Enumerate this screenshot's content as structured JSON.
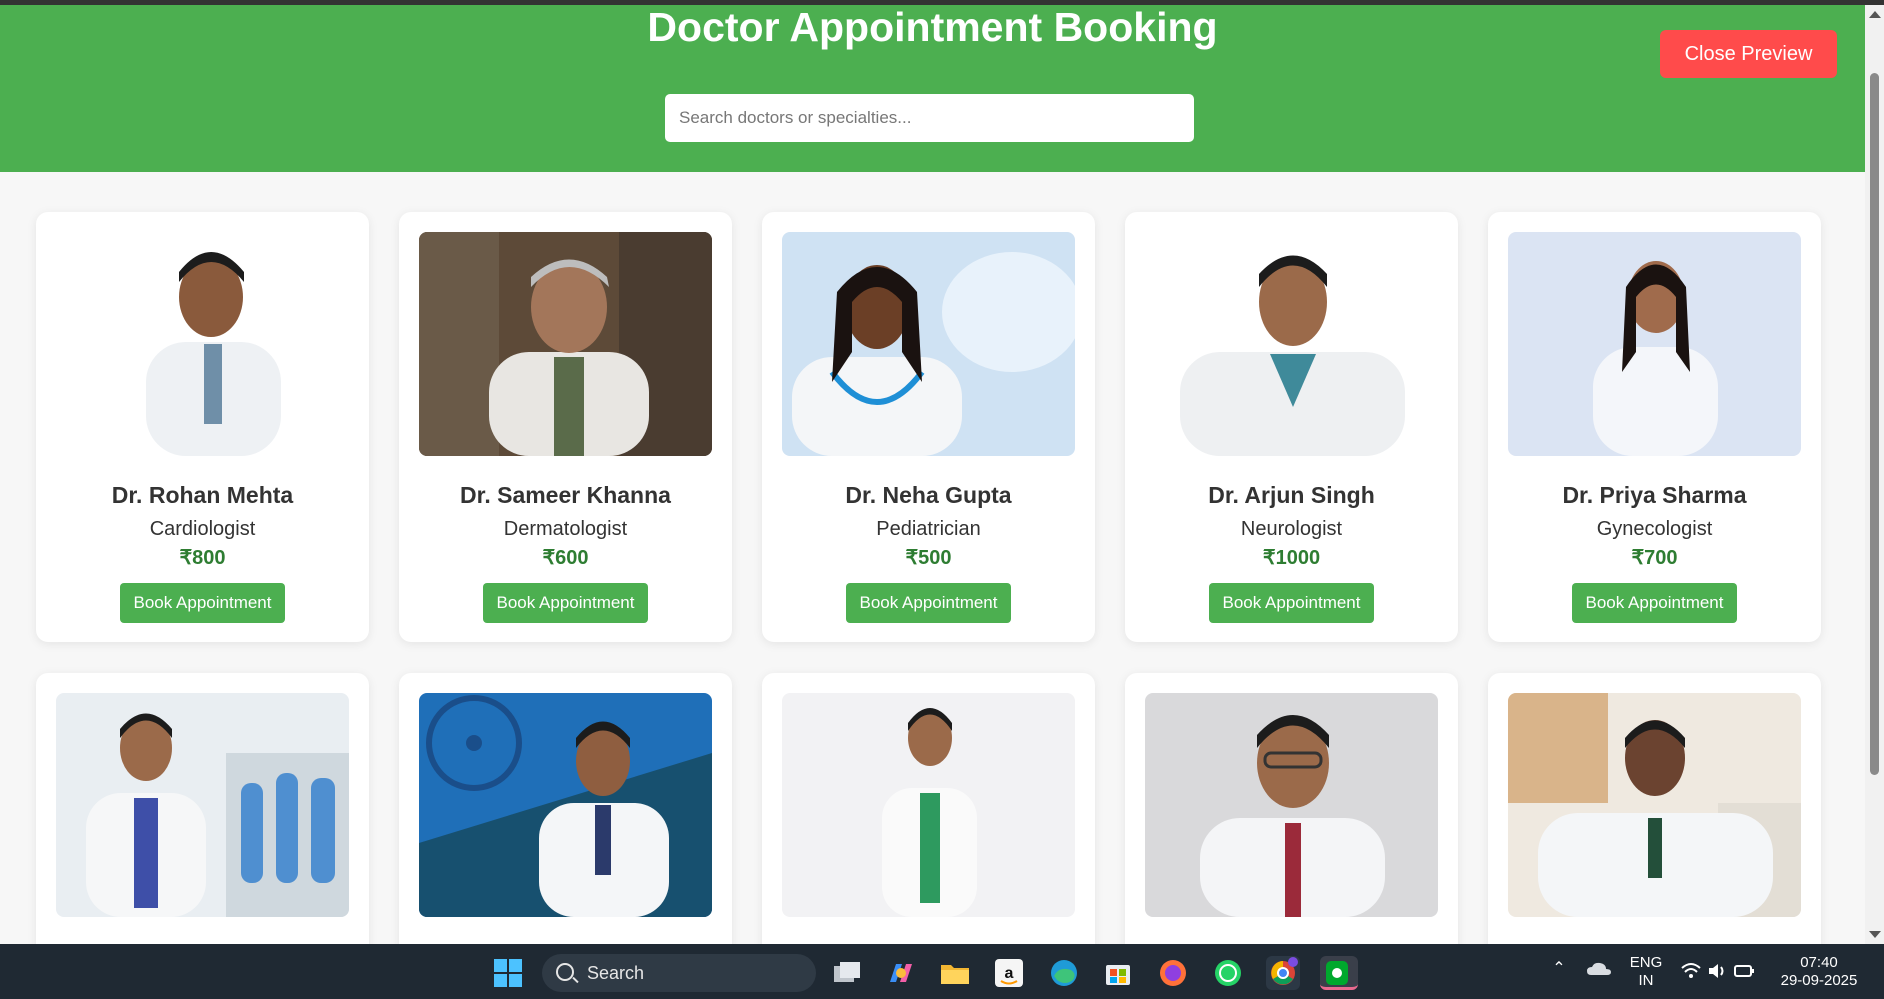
{
  "header": {
    "title": "Doctor Appointment Booking",
    "search_placeholder": "Search doctors or specialties...",
    "close_label": "Close Preview",
    "accent": "#4caf50"
  },
  "doctors": [
    {
      "name": "Dr. Rohan Mehta",
      "specialty": "Cardiologist",
      "fee": "₹800",
      "button": "Book Appointment"
    },
    {
      "name": "Dr. Sameer Khanna",
      "specialty": "Dermatologist",
      "fee": "₹600",
      "button": "Book Appointment"
    },
    {
      "name": "Dr. Neha Gupta",
      "specialty": "Pediatrician",
      "fee": "₹500",
      "button": "Book Appointment"
    },
    {
      "name": "Dr. Arjun Singh",
      "specialty": "Neurologist",
      "fee": "₹1000",
      "button": "Book Appointment"
    },
    {
      "name": "Dr. Priya Sharma",
      "specialty": "Gynecologist",
      "fee": "₹700",
      "button": "Book Appointment"
    }
  ],
  "taskbar": {
    "search_label": "Search",
    "lang_line1": "ENG",
    "lang_line2": "IN",
    "time": "07:40",
    "date": "29-09-2025",
    "apps": [
      "windows-start-icon",
      "task-view-icon",
      "copilot-icon",
      "file-explorer-icon",
      "amazon-icon",
      "edge-icon",
      "store-icon",
      "firefox-icon",
      "whatsapp-icon",
      "chrome-icon",
      "evernote-icon"
    ]
  }
}
